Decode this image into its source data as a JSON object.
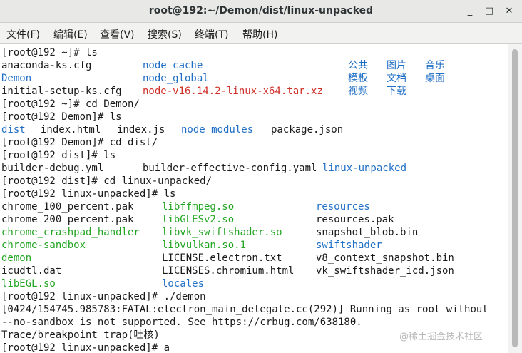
{
  "window": {
    "title": "root@192:~/Demon/dist/linux-unpacked"
  },
  "window_controls": {
    "minimize": "_",
    "maximize": "□",
    "close": "✕"
  },
  "menu": [
    "文件(F)",
    "编辑(E)",
    "查看(V)",
    "搜索(S)",
    "终端(T)",
    "帮助(H)"
  ],
  "terminal": {
    "lines": [
      [
        [
          "[root@192 ~]# ls",
          "ft"
        ]
      ],
      [
        [
          "anaconda-ks.cfg",
          "ft"
        ],
        [
          "node_cache",
          "dir"
        ],
        [
          "公共",
          "dir"
        ],
        [
          "图片",
          "dir"
        ],
        [
          "音乐",
          "dir"
        ]
      ],
      [
        [
          "Demon",
          "dir"
        ],
        [
          "node_global",
          "dir"
        ],
        [
          "模板",
          "dir"
        ],
        [
          "文档",
          "dir"
        ],
        [
          "桌面",
          "dir"
        ]
      ],
      [
        [
          "initial-setup-ks.cfg",
          "ft"
        ],
        [
          "node-v16.14.2-linux-x64.tar.xz",
          "arc"
        ],
        [
          "视频",
          "dir"
        ],
        [
          "下载",
          "dir"
        ]
      ],
      [
        [
          "[root@192 ~]# cd Demon/",
          "ft"
        ]
      ],
      [
        [
          "[root@192 Demon]# ls",
          "ft"
        ]
      ],
      [
        [
          "dist",
          "dir"
        ],
        [
          "index.html",
          "ft"
        ],
        [
          "index.js",
          "ft"
        ],
        [
          "node_modules",
          "dir"
        ],
        [
          "package.json",
          "ft"
        ]
      ],
      [
        [
          "[root@192 Demon]# cd dist/",
          "ft"
        ]
      ],
      [
        [
          "[root@192 dist]# ls",
          "ft"
        ]
      ],
      [
        [
          "builder-debug.yml",
          "ft"
        ],
        [
          "builder-effective-config.yaml",
          "ft"
        ],
        [
          "linux-unpacked",
          "dir"
        ]
      ],
      [
        [
          "[root@192 dist]# cd linux-unpacked/",
          "ft"
        ]
      ],
      [
        [
          "[root@192 linux-unpacked]# ls",
          "ft"
        ]
      ],
      [
        [
          "chrome_100_percent.pak",
          "ft"
        ],
        [
          "libffmpeg.so",
          "ex"
        ],
        [
          "resources",
          "dir"
        ]
      ],
      [
        [
          "chrome_200_percent.pak",
          "ft"
        ],
        [
          "libGLESv2.so",
          "ex"
        ],
        [
          "resources.pak",
          "ft"
        ]
      ],
      [
        [
          "chrome_crashpad_handler",
          "ex"
        ],
        [
          "libvk_swiftshader.so",
          "ex"
        ],
        [
          "snapshot_blob.bin",
          "ft"
        ]
      ],
      [
        [
          "chrome-sandbox",
          "ex"
        ],
        [
          "libvulkan.so.1",
          "ex"
        ],
        [
          "swiftshader",
          "dir"
        ]
      ],
      [
        [
          "demon",
          "ex"
        ],
        [
          "LICENSE.electron.txt",
          "ft"
        ],
        [
          "v8_context_snapshot.bin",
          "ft"
        ]
      ],
      [
        [
          "icudtl.dat",
          "ft"
        ],
        [
          "LICENSES.chromium.html",
          "ft"
        ],
        [
          "vk_swiftshader_icd.json",
          "ft"
        ]
      ],
      [
        [
          "libEGL.so",
          "ex"
        ],
        [
          "locales",
          "dir"
        ]
      ],
      [
        [
          "[root@192 linux-unpacked]# ./demon",
          "ft"
        ]
      ],
      [
        [
          "[0424/154745.985783:FATAL:electron_main_delegate.cc(292)] Running as root without",
          "ft"
        ]
      ],
      [
        [
          "--no-sandbox is not supported. See https://crbug.com/638180.",
          "ft"
        ]
      ],
      [
        [
          "Trace/breakpoint trap(吐核)",
          "ft"
        ]
      ],
      [
        [
          "[root@192 linux-unpacked]# a",
          "ft"
        ]
      ]
    ]
  },
  "watermark": "@稀土掘金技术社区"
}
